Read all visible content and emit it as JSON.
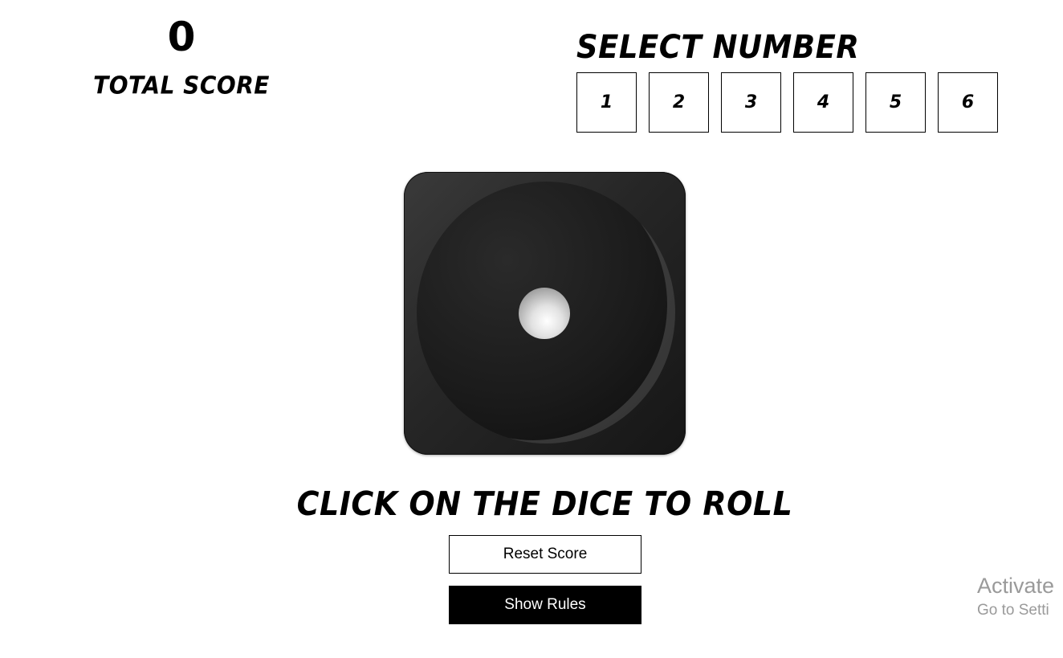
{
  "score": {
    "value": "0",
    "label": "Total Score"
  },
  "select_number": {
    "title": "Select Number",
    "options": [
      "1",
      "2",
      "3",
      "4",
      "5",
      "6"
    ]
  },
  "dice": {
    "face_value": 1,
    "color": "#262626"
  },
  "instruction": "Click on the dice to roll",
  "buttons": {
    "reset": "Reset Score",
    "rules": "Show Rules"
  },
  "watermark": {
    "title": "Activate",
    "subtitle": "Go to Setti"
  }
}
